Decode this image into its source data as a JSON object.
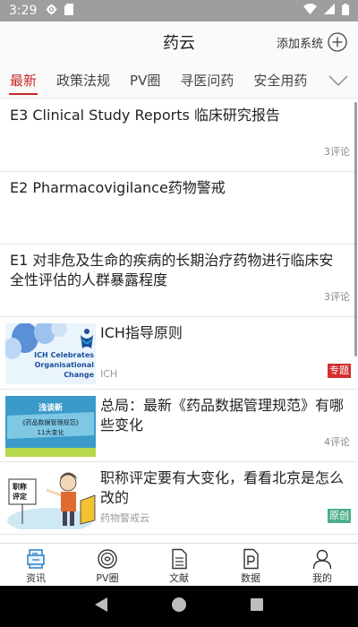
{
  "status_bar": {
    "time": "3:29"
  },
  "header": {
    "title": "药云",
    "add_label": "添加系统"
  },
  "tabs": [
    "最新",
    "政策法规",
    "PV圈",
    "寻医问药",
    "安全用药"
  ],
  "colors": {
    "accent": "#c62828",
    "badge_special": "#d32f2f",
    "badge_original": "#4caf8a"
  },
  "feed": [
    {
      "title": "E3 Clinical Study Reports 临床研究报告",
      "comments": "3评论"
    },
    {
      "title": "E2 Pharmacovigilance药物警戒",
      "comments": ""
    },
    {
      "title": "E1 对非危及生命的疾病的长期治疗药物进行临床安全性评估的人群暴露程度",
      "comments": "3评论"
    },
    {
      "title": "ICH指导原则",
      "source": "ICH",
      "badge": "专题",
      "thumb_caption": "ICH Celebrates Organisational Change"
    },
    {
      "title": "总局：最新《药品数据管理规范》有哪些变化",
      "comments": "4评论",
      "thumb_lines": [
        "浅谈新",
        "《药品数据管理规范》",
        "11大变化"
      ]
    },
    {
      "title": "职称评定要有大变化，看看北京是怎么改的",
      "source": "药物警戒云",
      "badge": "原创",
      "thumb_sign": [
        "职称",
        "评定"
      ]
    }
  ],
  "bottom_nav": [
    {
      "label": "资讯",
      "icon": "news-icon"
    },
    {
      "label": "PV圈",
      "icon": "pv-circle-icon"
    },
    {
      "label": "文献",
      "icon": "document-icon"
    },
    {
      "label": "数据",
      "icon": "data-icon"
    },
    {
      "label": "我的",
      "icon": "person-icon"
    }
  ]
}
